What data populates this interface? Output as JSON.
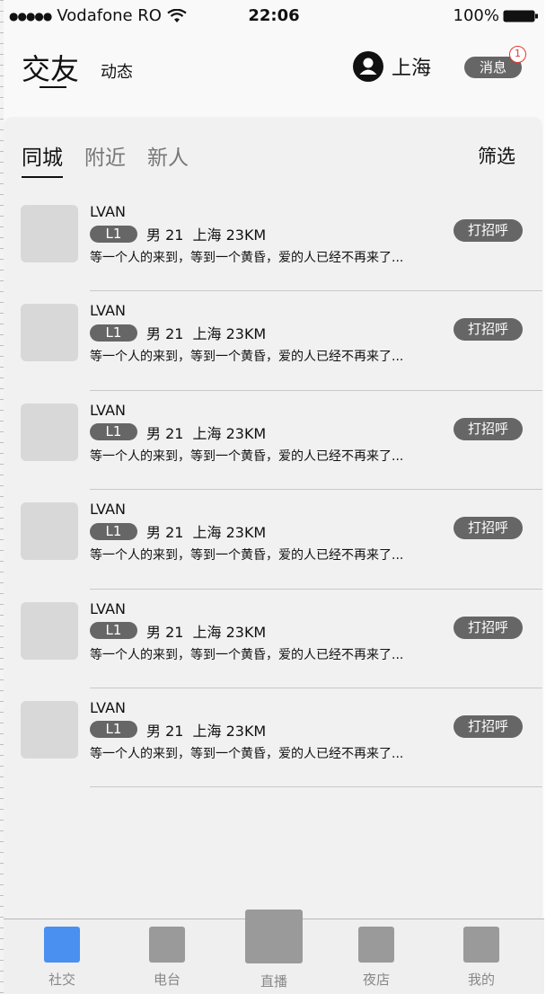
{
  "status_bar": {
    "carrier": "Vodafone RO",
    "time": "22:06",
    "battery": "100%"
  },
  "header": {
    "title": "交友",
    "subtitle": "动态",
    "location": "上海",
    "message_label": "消息",
    "message_badge": "1"
  },
  "tabs": {
    "items": [
      "同城",
      "附近",
      "新人"
    ],
    "active_index": 0,
    "filter_label": "筛选"
  },
  "list": [
    {
      "name": "LVAN",
      "level": "L1",
      "gender": "男",
      "age": "21",
      "city": "上海",
      "distance": "23KM",
      "bio": "等一个人的来到，等到一个黄昏，爱的人已经不再来了...",
      "action": "打招呼"
    },
    {
      "name": "LVAN",
      "level": "L1",
      "gender": "男",
      "age": "21",
      "city": "上海",
      "distance": "23KM",
      "bio": "等一个人的来到，等到一个黄昏，爱的人已经不再来了...",
      "action": "打招呼"
    },
    {
      "name": "LVAN",
      "level": "L1",
      "gender": "男",
      "age": "21",
      "city": "上海",
      "distance": "23KM",
      "bio": "等一个人的来到，等到一个黄昏，爱的人已经不再来了...",
      "action": "打招呼"
    },
    {
      "name": "LVAN",
      "level": "L1",
      "gender": "男",
      "age": "21",
      "city": "上海",
      "distance": "23KM",
      "bio": "等一个人的来到，等到一个黄昏，爱的人已经不再来了...",
      "action": "打招呼"
    },
    {
      "name": "LVAN",
      "level": "L1",
      "gender": "男",
      "age": "21",
      "city": "上海",
      "distance": "23KM",
      "bio": "等一个人的来到，等到一个黄昏，爱的人已经不再来了...",
      "action": "打招呼"
    },
    {
      "name": "LVAN",
      "level": "L1",
      "gender": "男",
      "age": "21",
      "city": "上海",
      "distance": "23KM",
      "bio": "等一个人的来到，等到一个黄昏，爱的人已经不再来了...",
      "action": "打招呼"
    }
  ],
  "tab_bar": {
    "items": [
      {
        "label": "社交",
        "icon": "social-icon",
        "active": true
      },
      {
        "label": "电台",
        "icon": "radio-icon",
        "active": false
      },
      {
        "label": "直播",
        "icon": "live-icon",
        "active": false
      },
      {
        "label": "夜店",
        "icon": "nightclub-icon",
        "active": false
      },
      {
        "label": "我的",
        "icon": "profile-icon",
        "active": false
      }
    ]
  },
  "colors": {
    "accent_active": "#4a90f0",
    "chip": "#666666",
    "badge_border": "#e03a2f"
  }
}
